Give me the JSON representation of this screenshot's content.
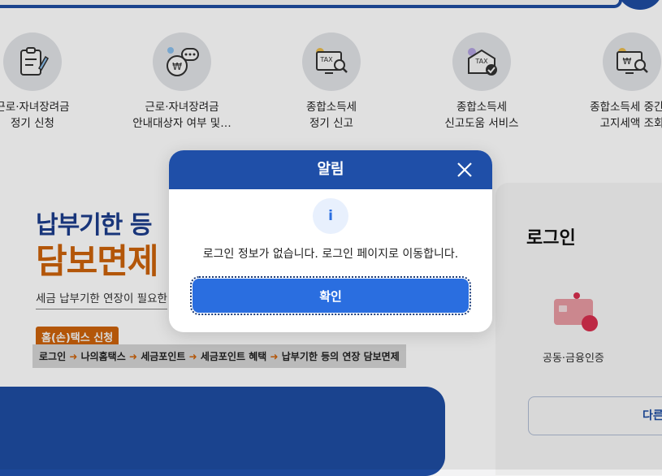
{
  "services": [
    {
      "line1": "근로·자녀장려금",
      "line2": "정기 신청",
      "icon": "clipboard-pencil-icon"
    },
    {
      "line1": "근로·자녀장려금",
      "line2": "안내대상자 여부 및…",
      "icon": "money-bag-chat-icon"
    },
    {
      "line1": "종합소득세",
      "line2": "정기 신고",
      "icon": "tax-monitor-search-icon"
    },
    {
      "line1": "종합소득세",
      "line2": "신고도움 서비스",
      "icon": "tax-document-check-icon"
    },
    {
      "line1": "종합소득세 중간예",
      "line2": "고지세액 조회",
      "icon": "monitor-won-search-icon"
    }
  ],
  "banner": {
    "title_line1": "납부기한 등",
    "title_line2": "담보면제",
    "subtitle": "세금 납부기한 연장이 필요한",
    "badge": "홈(손)택스 신청",
    "steps": [
      "로그인",
      "나의홈택스",
      "세금포인트",
      "세금포인트 혜택",
      "납부기한 등의 연장 담보면제"
    ]
  },
  "login": {
    "title": "로그인",
    "cert_label": "공동·금융인증",
    "other_button": "다른"
  },
  "modal": {
    "title": "알림",
    "info_glyph": "i",
    "message": "로그인 정보가 없습니다. 로그인 페이지로 이동합니다.",
    "confirm_label": "확인"
  },
  "colors": {
    "primary": "#1f4fa8",
    "button": "#2a6ee0",
    "accent": "#d4660b"
  }
}
